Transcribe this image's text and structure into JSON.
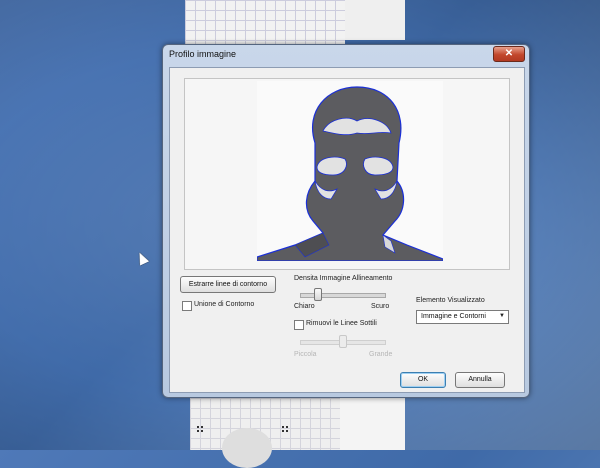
{
  "dialog": {
    "title": "Profilo immagine",
    "close_glyph": "✕",
    "extract_button": "Estrarre linee di contorno",
    "merge_checkbox_label": "Unione di Contorno",
    "density": {
      "title": "Densita Immagine Allineamento",
      "min_label": "Chiaro",
      "max_label": "Scuro",
      "level": 0.2
    },
    "thin_lines_checkbox_label": "Rimuovi le Linee Sottili",
    "thin_slider": {
      "min_label": "Piccola",
      "max_label": "Grande",
      "level": 0.5,
      "enabled": false
    },
    "display_element": {
      "title": "Elemento Visualizzato",
      "selected": "Immagine e Contorni"
    },
    "ok_label": "OK",
    "cancel_label": "Annulla"
  },
  "colors": {
    "desktop": "#4f79b8",
    "silhouette_fill": "#5c5c60",
    "contour": "#1a2fd8"
  },
  "icons": [
    "close-icon",
    "dropdown-arrow-icon",
    "cursor-icon",
    "grid-icon"
  ]
}
